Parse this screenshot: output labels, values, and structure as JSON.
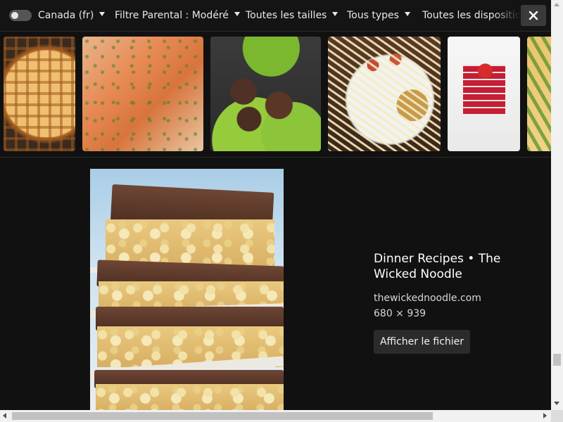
{
  "topbar": {
    "region_label": "Canada (fr)",
    "filters": [
      {
        "label": "Filtre Parental : Modéré"
      },
      {
        "label": "Toutes les tailles"
      },
      {
        "label": "Tous types"
      },
      {
        "label": "Toutes les dispositio"
      }
    ],
    "close_icon": "close-icon",
    "toggle_state": "off"
  },
  "thumbnails": [
    {
      "name": "lattice-pie-thumbnail"
    },
    {
      "name": "salmon-thumbnail"
    },
    {
      "name": "meatballs-thumbnail"
    },
    {
      "name": "pasta-plate-thumbnail"
    },
    {
      "name": "red-velvet-pancakes-thumbnail"
    },
    {
      "name": "vegetable-tart-thumbnail"
    }
  ],
  "preview": {
    "title": "Dinner Recipes • The Wicked Noodle",
    "domain": "thewickednoodle.com",
    "dimensions": "680 × 939",
    "open_button_label": "Afficher le fichier"
  },
  "colors": {
    "background": "#111111",
    "topbar": "#141414",
    "button": "#2b2b2b",
    "close_button": "#3a3a3a"
  }
}
